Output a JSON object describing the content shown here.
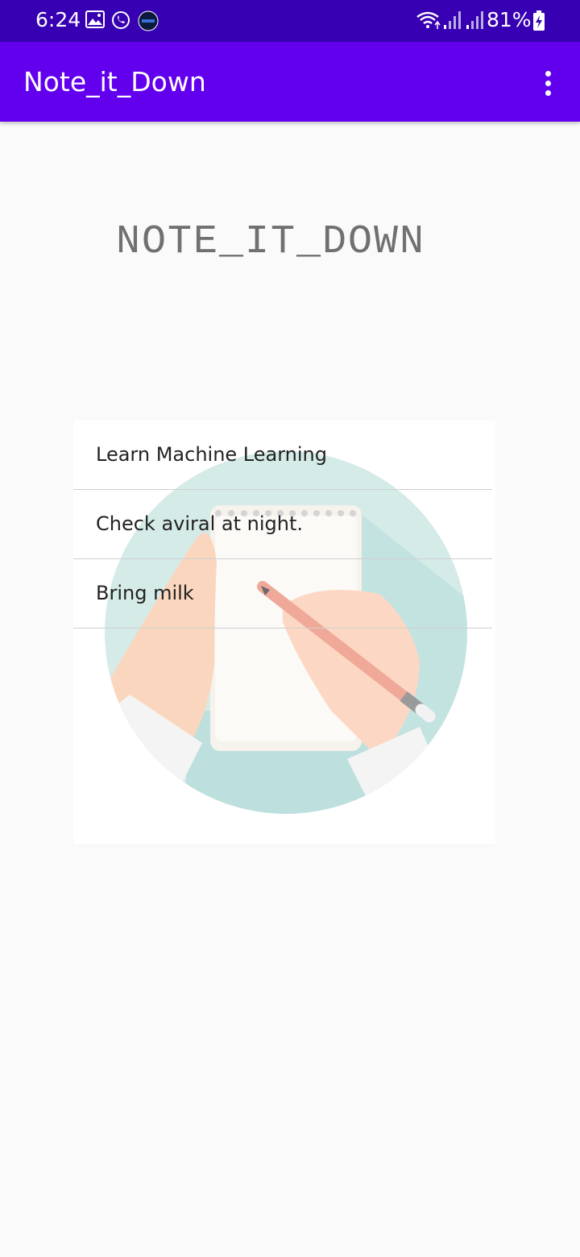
{
  "status_bar": {
    "time": "6:24",
    "battery": "81%",
    "icons": [
      "image-icon",
      "whatsapp-icon",
      "app-notification-icon",
      "wifi-icon",
      "signal-icon",
      "signal-icon",
      "battery-charging-icon"
    ]
  },
  "app_bar": {
    "title": "Note_it_Down",
    "menu_icon": "overflow-menu-icon",
    "color": "#6200ee"
  },
  "header": {
    "title": "NOTE_IT_DOWN"
  },
  "notes": [
    {
      "text": "Learn Machine Learning"
    },
    {
      "text": "Check aviral at night."
    },
    {
      "text": "Bring milk"
    }
  ],
  "colors": {
    "status_bar": "#3700b3",
    "app_bar": "#6200ee",
    "background": "#fafafa"
  }
}
